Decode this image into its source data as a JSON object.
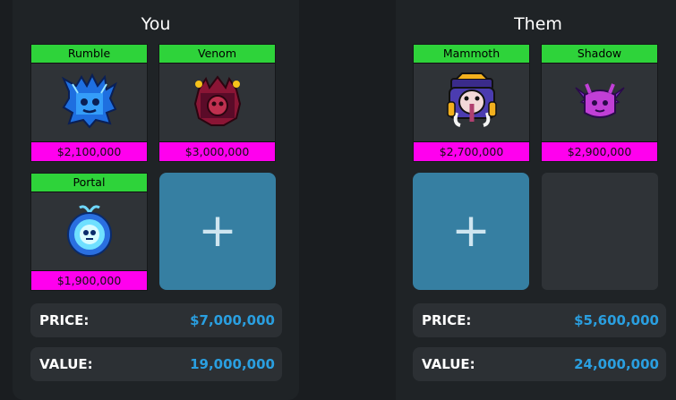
{
  "you": {
    "heading": "You",
    "items": [
      {
        "name": "Rumble",
        "price": "$2,100,000",
        "icon": "rumble-fruit-icon"
      },
      {
        "name": "Venom",
        "price": "$3,000,000",
        "icon": "venom-fruit-icon"
      },
      {
        "name": "Portal",
        "price": "$1,900,000",
        "icon": "portal-fruit-icon"
      }
    ],
    "add_symbol": "+",
    "price_label": "PRICE:",
    "price_value": "$7,000,000",
    "value_label": "VALUE:",
    "value_value": "19,000,000"
  },
  "them": {
    "heading": "Them",
    "items": [
      {
        "name": "Mammoth",
        "price": "$2,700,000",
        "icon": "mammoth-fruit-icon"
      },
      {
        "name": "Shadow",
        "price": "$2,900,000",
        "icon": "shadow-fruit-icon"
      }
    ],
    "add_symbol": "+",
    "price_label": "PRICE:",
    "price_value": "$5,600,000",
    "value_label": "VALUE:",
    "value_value": "24,000,000"
  },
  "colors": {
    "name_bar": "#2ed33a",
    "price_bar": "#ff00ee",
    "add_button": "#367fa2",
    "value_text": "#2a9fe0"
  }
}
